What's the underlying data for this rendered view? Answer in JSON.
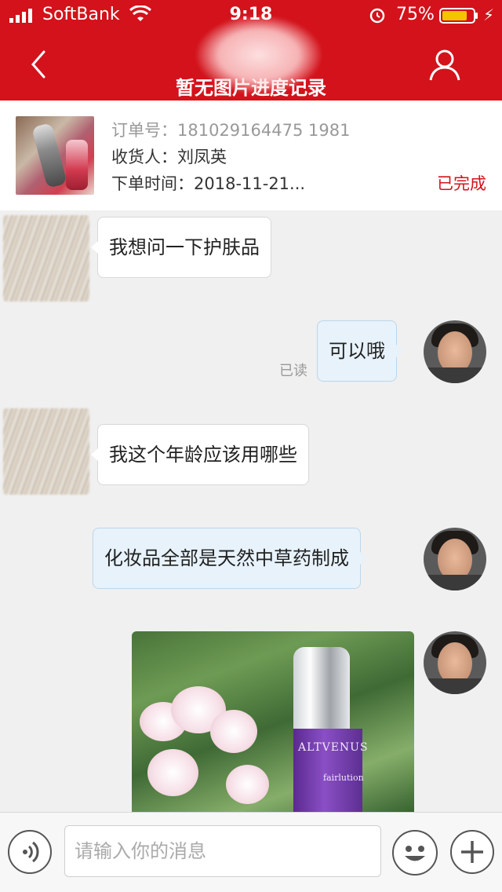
{
  "status_bar": {
    "carrier": "SoftBank",
    "time": "9:18",
    "battery": "75%"
  },
  "nav": {
    "title": "暂无图片进度记录"
  },
  "order": {
    "order_no": "订单号：181029164475 1981",
    "receiver": "收货人：刘凤英",
    "time": "下单时间：2018-11-21...",
    "status": "已完成"
  },
  "messages": [
    {
      "side": "left",
      "text": "我想问一下护肤品"
    },
    {
      "side": "right",
      "text": "可以哦",
      "read": "已读"
    },
    {
      "side": "left",
      "text": "我这个年龄应该用哪些"
    },
    {
      "side": "right",
      "text": "化妆品全部是天然中草药制成"
    }
  ],
  "product_image": {
    "brand": "ALTVENUS",
    "sub": "fairlution"
  },
  "input": {
    "placeholder": "请输入你的消息"
  },
  "colors": {
    "header": "#d3121b",
    "status_done": "#d3121b"
  }
}
